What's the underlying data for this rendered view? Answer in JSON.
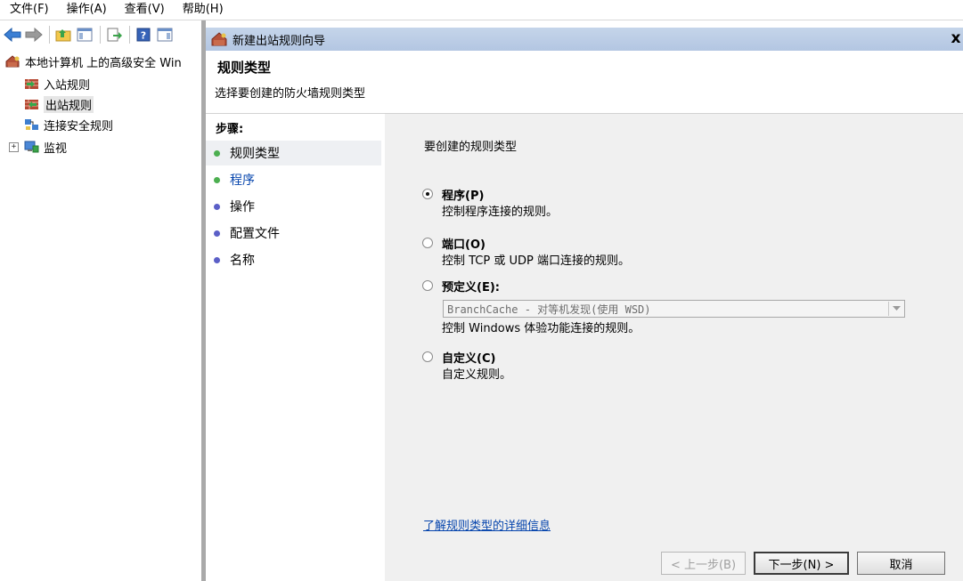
{
  "menu": [
    "文件(F)",
    "操作(A)",
    "查看(V)",
    "帮助(H)"
  ],
  "tree": {
    "root": "本地计算机 上的高级安全 Win",
    "items": [
      {
        "label": "入站规则"
      },
      {
        "label": "出站规则",
        "selected": true
      },
      {
        "label": "连接安全规则"
      },
      {
        "label": "监视",
        "expander": "+"
      }
    ]
  },
  "wizard": {
    "window_title": "新建出站规则向导",
    "close_glyph": "x",
    "page_title": "规则类型",
    "page_subtitle": "选择要创建的防火墙规则类型",
    "steps_title": "步骤:",
    "steps": [
      {
        "label": "规则类型",
        "state": "current",
        "dot_color": "#4caf50"
      },
      {
        "label": "程序",
        "state": "active",
        "dot_color": "#4caf50"
      },
      {
        "label": "操作",
        "state": "pending",
        "dot_color": "#5b5fc7"
      },
      {
        "label": "配置文件",
        "state": "pending",
        "dot_color": "#5b5fc7"
      },
      {
        "label": "名称",
        "state": "pending",
        "dot_color": "#5b5fc7"
      }
    ],
    "content_heading": "要创建的规则类型",
    "options": [
      {
        "label": "程序(P)",
        "desc": "控制程序连接的规则。",
        "checked": true
      },
      {
        "label": "端口(O)",
        "desc": "控制 TCP 或 UDP 端口连接的规则。",
        "checked": false
      },
      {
        "label": "预定义(E):",
        "desc": "控制 Windows 体验功能连接的规则。",
        "checked": false
      },
      {
        "label": "自定义(C)",
        "desc": "自定义规则。",
        "checked": false
      }
    ],
    "predefined_select": "BranchCache - 对等机发现(使用 WSD)",
    "learn_more_link": "了解规则类型的详细信息",
    "buttons": {
      "back": "< 上一步(B)",
      "next": "下一步(N) >",
      "cancel": "取消"
    }
  }
}
